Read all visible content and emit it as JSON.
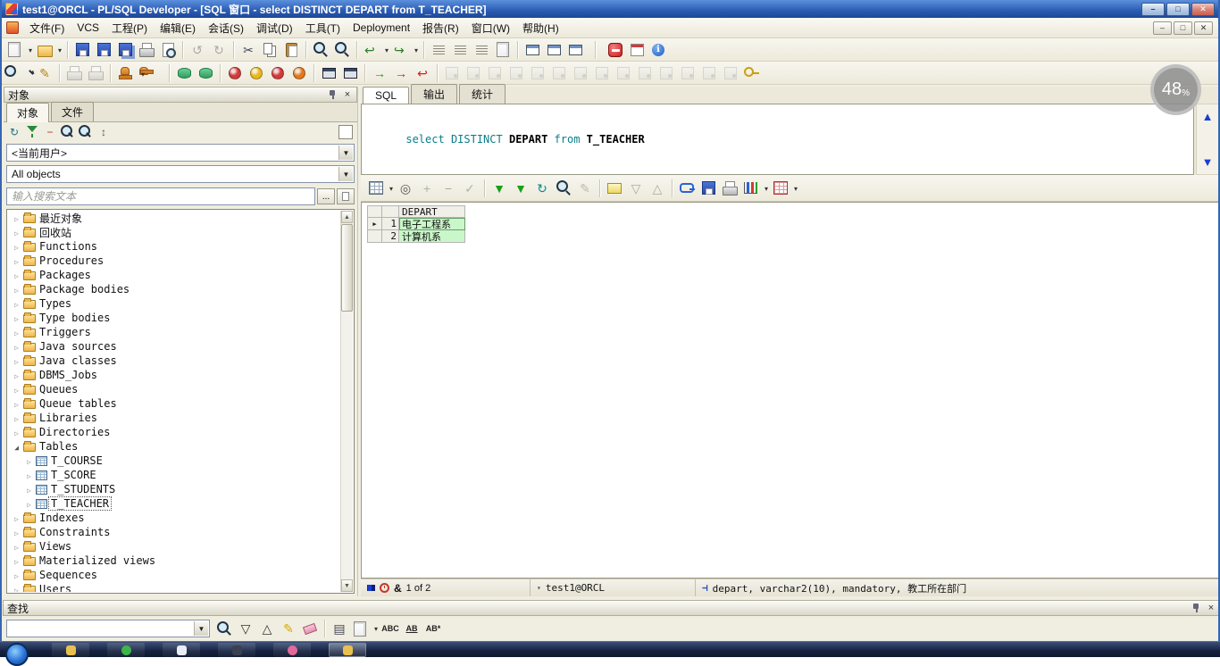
{
  "window": {
    "title": "test1@ORCL - PL/SQL Developer - [SQL 窗口 - select DISTINCT DEPART from T_TEACHER]"
  },
  "overlay_badge": {
    "value": "48",
    "unit": "%"
  },
  "menu": {
    "items": [
      "文件(F)",
      "VCS",
      "工程(P)",
      "编辑(E)",
      "会话(S)",
      "调试(D)",
      "工具(T)",
      "Deployment",
      "报告(R)",
      "窗口(W)",
      "帮助(H)"
    ]
  },
  "toolbar_main": [
    {
      "name": "new-document-button",
      "cls": "tbi s-page drop"
    },
    {
      "name": "open-file-button",
      "cls": "tbi s-folderic drop"
    },
    {
      "cls": "tsep"
    },
    {
      "name": "save-button",
      "cls": "tbi s-floppy"
    },
    {
      "name": "save-as-button",
      "cls": "tbi s-floppy"
    },
    {
      "name": "save-all-button",
      "cls": "tbi s-floppy s-floppy2"
    },
    {
      "name": "print-button",
      "cls": "tbi s-printer"
    },
    {
      "name": "print-preview-button",
      "cls": "tbi s-preview"
    },
    {
      "cls": "tsep"
    },
    {
      "name": "undo-button",
      "cls": "tbi gly grayed",
      "glyph": "↺",
      "color": "#555"
    },
    {
      "name": "redo-button",
      "cls": "tbi gly grayed",
      "glyph": "↻",
      "color": "#555"
    },
    {
      "cls": "tsep"
    },
    {
      "name": "cut-button",
      "cls": "tbi gly",
      "glyph": "✂",
      "color": "#445"
    },
    {
      "name": "copy-button",
      "cls": "tbi s-copy"
    },
    {
      "name": "paste-button",
      "cls": "tbi s-clip"
    },
    {
      "cls": "tsep"
    },
    {
      "name": "find-button",
      "cls": "tbi s-mag"
    },
    {
      "name": "find-next-button",
      "cls": "tbi s-mag"
    },
    {
      "cls": "tsep"
    },
    {
      "name": "previous-edit-button",
      "cls": "tbi gly drop",
      "glyph": "↩",
      "color": "#2a7d2a"
    },
    {
      "name": "next-edit-button",
      "cls": "tbi gly drop",
      "glyph": "↪",
      "color": "#2a7d2a"
    },
    {
      "cls": "tsep"
    },
    {
      "name": "indent-button",
      "cls": "tbi s-lines"
    },
    {
      "name": "unindent-button",
      "cls": "tbi s-lines"
    },
    {
      "name": "comment-button",
      "cls": "tbi s-lines"
    },
    {
      "name": "beautifier-button",
      "cls": "tbi s-page"
    },
    {
      "cls": "tsep"
    },
    {
      "name": "cascade-windows-button",
      "cls": "tbi s-win"
    },
    {
      "name": "tile-windows-button",
      "cls": "tbi s-win"
    },
    {
      "name": "arrange-windows-button",
      "cls": "tbi s-win"
    },
    {
      "cls": "tsep gap"
    },
    {
      "name": "disconnect-button",
      "cls": "tbi s-stop"
    },
    {
      "name": "to-do-list-button",
      "cls": "tbi s-cal"
    },
    {
      "name": "about-button",
      "cls": "tbi s-info"
    }
  ],
  "toolbar_session": [
    {
      "name": "browser-button",
      "cls": "tbi s-mag drop"
    },
    {
      "name": "describe-button",
      "cls": "tbi gly",
      "glyph": "✎",
      "color": "#b8860b"
    },
    {
      "cls": "tsep"
    },
    {
      "name": "command-window-button",
      "cls": "tbi s-printer grayed"
    },
    {
      "name": "report-window-button",
      "cls": "tbi s-printer grayed"
    },
    {
      "cls": "tsep"
    },
    {
      "name": "stamp-button",
      "cls": "tbi s-stamp"
    },
    {
      "name": "stamp-options-button",
      "cls": "tbi s-stamp drop"
    },
    {
      "cls": "tsep"
    },
    {
      "name": "export-tables-button",
      "cls": "tbi s-db"
    },
    {
      "name": "import-tables-button",
      "cls": "tbi s-db"
    },
    {
      "cls": "tsep"
    },
    {
      "name": "commit-button",
      "cls": "tbi s-ball c-red"
    },
    {
      "name": "rollback-button",
      "cls": "tbi s-ball c-yellow"
    },
    {
      "name": "break-button",
      "cls": "tbi s-ball c-red"
    },
    {
      "name": "kill-session-button",
      "cls": "tbi s-ball c-orange"
    },
    {
      "cls": "tsep"
    },
    {
      "name": "window-list-button",
      "cls": "tbi s-windark"
    },
    {
      "name": "dockable-windows-button",
      "cls": "tbi s-windark"
    },
    {
      "cls": "tsep"
    },
    {
      "name": "execute-button",
      "cls": "tbi gly",
      "glyph": "→",
      "color": "#18a018"
    },
    {
      "name": "execute-step-button",
      "cls": "tbi gly",
      "glyph": "→",
      "color": "#d02020"
    },
    {
      "name": "stop-execution-button",
      "cls": "tbi gly",
      "glyph": "↩",
      "color": "#d02020"
    },
    {
      "cls": "tsep"
    },
    {
      "name": "session-action-button",
      "cls": "tbi s-sess grayed"
    },
    {
      "name": "session-action-button",
      "cls": "tbi s-sess grayed"
    },
    {
      "name": "session-action-button",
      "cls": "tbi s-sess grayed"
    },
    {
      "name": "session-action-button",
      "cls": "tbi s-sess grayed"
    },
    {
      "name": "session-action-button",
      "cls": "tbi s-sess grayed"
    },
    {
      "name": "session-action-button",
      "cls": "tbi s-sess grayed"
    },
    {
      "name": "session-action-button",
      "cls": "tbi s-sess grayed"
    },
    {
      "name": "session-action-button",
      "cls": "tbi s-sess grayed"
    },
    {
      "name": "session-action-button",
      "cls": "tbi s-sess grayed"
    },
    {
      "name": "session-action-button",
      "cls": "tbi s-sess grayed"
    },
    {
      "name": "session-action-button",
      "cls": "tbi s-sess grayed"
    },
    {
      "name": "session-action-button",
      "cls": "tbi s-sess grayed"
    },
    {
      "name": "session-action-button",
      "cls": "tbi s-sess grayed"
    },
    {
      "name": "session-action-button",
      "cls": "tbi s-sess grayed"
    },
    {
      "name": "license-key-button",
      "cls": "tbi s-key"
    }
  ],
  "object_panel": {
    "title": "对象",
    "tabs": [
      {
        "name": "tab-objects",
        "label": "对象",
        "active": true
      },
      {
        "name": "tab-files",
        "label": "文件"
      }
    ],
    "toolbar": [
      {
        "name": "refresh-button",
        "cls": "tbi16 gly",
        "glyph": "↻",
        "color": "#18728a"
      },
      {
        "name": "filter-button",
        "cls": "tbi16 s-funnel"
      },
      {
        "name": "collapse-all-button",
        "cls": "tbi16 gly",
        "glyph": "−",
        "color": "#b03030"
      },
      {
        "name": "find-object-button",
        "cls": "tbi16 s-mag"
      },
      {
        "name": "find-next-object-button",
        "cls": "tbi16 s-mag"
      },
      {
        "name": "sort-button",
        "cls": "tbi16 gly",
        "glyph": "↕",
        "color": "#555"
      }
    ],
    "current_user_filter": "<当前用户>",
    "object_type_filter": "All objects",
    "search_placeholder": "输入搜索文本",
    "browse_button": "...",
    "tree_items": [
      {
        "name": "tree-item-recent-objects",
        "label": "最近对象",
        "icon": "folder"
      },
      {
        "name": "tree-item-recycle-bin",
        "label": "回收站",
        "icon": "folder"
      },
      {
        "name": "tree-item-functions",
        "label": "Functions",
        "icon": "folder"
      },
      {
        "name": "tree-item-procedures",
        "label": "Procedures",
        "icon": "folder"
      },
      {
        "name": "tree-item-packages",
        "label": "Packages",
        "icon": "folder"
      },
      {
        "name": "tree-item-package-bodies",
        "label": "Package bodies",
        "icon": "folder"
      },
      {
        "name": "tree-item-types",
        "label": "Types",
        "icon": "folder"
      },
      {
        "name": "tree-item-type-bodies",
        "label": "Type bodies",
        "icon": "folder"
      },
      {
        "name": "tree-item-triggers",
        "label": "Triggers",
        "icon": "folder"
      },
      {
        "name": "tree-item-java-sources",
        "label": "Java sources",
        "icon": "folder"
      },
      {
        "name": "tree-item-java-classes",
        "label": "Java classes",
        "icon": "folder"
      },
      {
        "name": "tree-item-dbms-jobs",
        "label": "DBMS_Jobs",
        "icon": "folder"
      },
      {
        "name": "tree-item-queues",
        "label": "Queues",
        "icon": "folder"
      },
      {
        "name": "tree-item-queue-tables",
        "label": "Queue tables",
        "icon": "folder"
      },
      {
        "name": "tree-item-libraries",
        "label": "Libraries",
        "icon": "folder"
      },
      {
        "name": "tree-item-directories",
        "label": "Directories",
        "icon": "folder"
      },
      {
        "name": "tree-item-tables",
        "label": "Tables",
        "icon": "folder",
        "expanded": true
      },
      {
        "name": "tree-item-t-course",
        "label": "T_COURSE",
        "icon": "table",
        "level": 1
      },
      {
        "name": "tree-item-t-score",
        "label": "T_SCORE",
        "icon": "table",
        "level": 1
      },
      {
        "name": "tree-item-t-students",
        "label": "T_STUDENTS",
        "icon": "table",
        "level": 1
      },
      {
        "name": "tree-item-t-teacher",
        "label": "T_TEACHER",
        "icon": "table",
        "level": 1,
        "selected": true
      },
      {
        "name": "tree-item-indexes",
        "label": "Indexes",
        "icon": "folder"
      },
      {
        "name": "tree-item-constraints",
        "label": "Constraints",
        "icon": "folder"
      },
      {
        "name": "tree-item-views",
        "label": "Views",
        "icon": "folder"
      },
      {
        "name": "tree-item-materialized-views",
        "label": "Materialized views",
        "icon": "folder"
      },
      {
        "name": "tree-item-sequences",
        "label": "Sequences",
        "icon": "folder"
      },
      {
        "name": "tree-item-users",
        "label": "Users",
        "icon": "folder"
      }
    ]
  },
  "sql_window": {
    "tabs": [
      {
        "name": "tab-sql",
        "label": "SQL",
        "active": true
      },
      {
        "name": "tab-output",
        "label": "输出"
      },
      {
        "name": "tab-statistics",
        "label": "统计"
      }
    ],
    "editor_tokens": [
      {
        "text": "select ",
        "cls": "kw"
      },
      {
        "text": "DISTINCT ",
        "cls": "kw"
      },
      {
        "text": "DEPART ",
        "cls": "id"
      },
      {
        "text": "from ",
        "cls": "kw"
      },
      {
        "text": "T_TEACHER",
        "cls": "id"
      }
    ],
    "result_grid": {
      "columns": [
        "DEPART"
      ],
      "rows": [
        {
          "num": "1",
          "depart": "电子工程系",
          "current": true
        },
        {
          "num": "2",
          "depart": "计算机系"
        }
      ]
    },
    "status_bar": {
      "ampersand": "&",
      "row_position": "1 of 2",
      "connection": "test1@ORCL",
      "column_info": "depart, varchar2(10), mandatory, 教工所在部门"
    }
  },
  "toolbar_grid": [
    {
      "name": "grid-options-button",
      "cls": "tbi s-grid drop"
    },
    {
      "name": "single-record-view-button",
      "cls": "tbi gly",
      "glyph": "◎",
      "color": "#555"
    },
    {
      "name": "insert-record-button",
      "cls": "tbi gly grayed",
      "glyph": "+",
      "color": "#2a7d2a"
    },
    {
      "name": "delete-record-button",
      "cls": "tbi gly grayed",
      "glyph": "−",
      "color": "#b03030"
    },
    {
      "name": "post-changes-button",
      "cls": "tbi gly grayed",
      "glyph": "✓",
      "color": "#2a7d2a"
    },
    {
      "cls": "tsep"
    },
    {
      "name": "fetch-next-page-button",
      "cls": "tbi gly",
      "glyph": "▼",
      "color": "#18a018"
    },
    {
      "name": "fetch-last-page-button",
      "cls": "tbi gly",
      "glyph": "▼",
      "color": "#18a018"
    },
    {
      "name": "refresh-results-button",
      "cls": "tbi gly",
      "glyph": "↻",
      "color": "#0a8a8a"
    },
    {
      "name": "find-in-results-button",
      "cls": "tbi s-mag"
    },
    {
      "name": "edit-cell-button",
      "cls": "tbi gly grayed",
      "glyph": "✎",
      "color": "#777"
    },
    {
      "cls": "tsep"
    },
    {
      "name": "export-results-button",
      "cls": "tbi s-envelope"
    },
    {
      "name": "sort-descending-button",
      "cls": "tbi gly grayed",
      "glyph": "▽",
      "color": "#555"
    },
    {
      "name": "sort-ascending-button",
      "cls": "tbi gly grayed",
      "glyph": "△",
      "color": "#555"
    },
    {
      "cls": "tsep"
    },
    {
      "name": "linked-query-button",
      "cls": "tbi s-link"
    },
    {
      "name": "save-results-button",
      "cls": "tbi s-floppy"
    },
    {
      "name": "copy-results-button",
      "cls": "tbi s-printer"
    },
    {
      "name": "chart-window-button",
      "cls": "tbi s-chart drop"
    },
    {
      "name": "report-window-button",
      "cls": "tbi s-gridred drop"
    }
  ],
  "find_panel": {
    "title": "查找"
  },
  "toolbar_find": [
    {
      "name": "find-text-button",
      "cls": "tbi s-mag"
    },
    {
      "name": "find-next-button",
      "cls": "tbi gly",
      "glyph": "▽",
      "color": "#333"
    },
    {
      "name": "find-previous-button",
      "cls": "tbi gly",
      "glyph": "△",
      "color": "#333"
    },
    {
      "name": "highlight-button",
      "cls": "tbi gly",
      "glyph": "✎",
      "color": "#d8a800"
    },
    {
      "name": "clear-highlight-button",
      "cls": "tbi s-eraser"
    },
    {
      "cls": "tsep"
    },
    {
      "name": "result-list-button",
      "cls": "tbi gly",
      "glyph": "▤",
      "color": "#445"
    },
    {
      "name": "search-scope-button",
      "cls": "tbi s-page drop"
    },
    {
      "name": "match-case-button",
      "cls": "tbi txtic",
      "glyph": "ABC"
    },
    {
      "name": "whole-word-button",
      "cls": "tbi txtic uline",
      "glyph": "AB"
    },
    {
      "name": "regex-button",
      "cls": "tbi txtic",
      "glyph": "AB*"
    }
  ],
  "taskbar": {
    "apps": [
      {
        "name": "taskbar-app",
        "cls": "c-folder"
      },
      {
        "name": "taskbar-app",
        "cls": "c-green"
      },
      {
        "name": "taskbar-app",
        "cls": "c-white"
      },
      {
        "name": "taskbar-app",
        "cls": "c-dark"
      },
      {
        "name": "taskbar-app",
        "cls": "c-pink"
      },
      {
        "name": "taskbar-app",
        "cls": "c-folder active"
      }
    ]
  }
}
